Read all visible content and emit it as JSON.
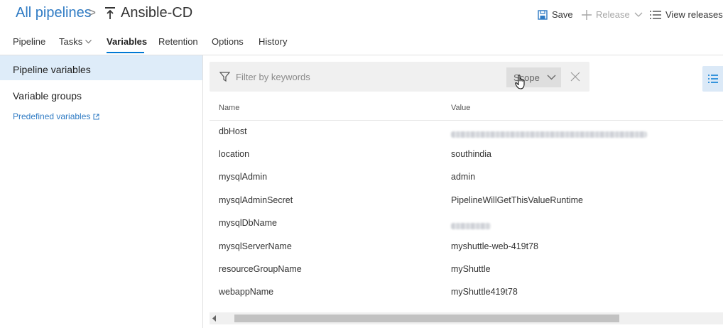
{
  "header": {
    "breadcrumb": "All pipelines",
    "breadcrumb_separator": ">",
    "title": "Ansible-CD",
    "actions": {
      "save": "Save",
      "release": "Release",
      "view_releases": "View releases"
    }
  },
  "tabs": [
    "Pipeline",
    "Tasks",
    "Variables",
    "Retention",
    "Options",
    "History"
  ],
  "active_tab": "Variables",
  "sidebar": {
    "items": [
      "Pipeline variables",
      "Variable groups"
    ],
    "link": "Predefined variables"
  },
  "filter": {
    "placeholder": "Filter by keywords",
    "scope_label": "Scope"
  },
  "table": {
    "columns": [
      "Name",
      "Value"
    ],
    "rows": [
      {
        "name": "dbHost",
        "value": "",
        "blurred": true
      },
      {
        "name": "location",
        "value": "southindia"
      },
      {
        "name": "mysqlAdmin",
        "value": "admin"
      },
      {
        "name": "mysqlAdminSecret",
        "value": "PipelineWillGetThisValueRuntime"
      },
      {
        "name": "mysqlDbName",
        "value": "",
        "blurred": true
      },
      {
        "name": "mysqlServerName",
        "value": "myshuttle-web-419t78"
      },
      {
        "name": "resourceGroupName",
        "value": "myShuttle"
      },
      {
        "name": "webappName",
        "value": "myShuttle419t78"
      }
    ]
  },
  "colors": {
    "accent": "#0078d4",
    "link": "#2f7bc4",
    "selected_nav": "#deecf9"
  }
}
